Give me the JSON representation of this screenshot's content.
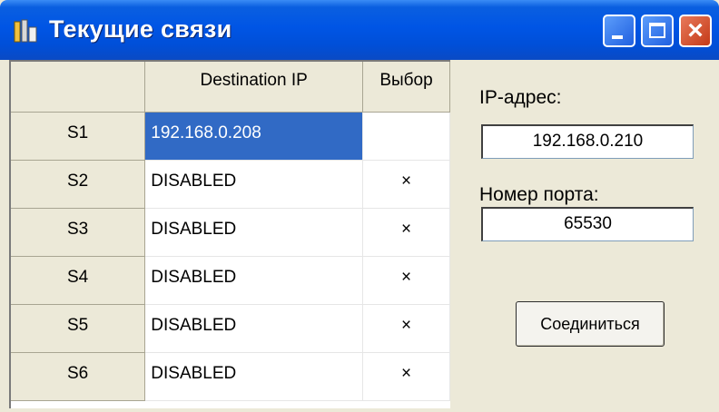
{
  "window": {
    "title": "Текущие связи",
    "controls": [
      "minimize",
      "maximize",
      "close"
    ]
  },
  "grid": {
    "columns": [
      "",
      "Destination IP",
      "Выбор"
    ],
    "rows": [
      {
        "id": "S1",
        "ip": "192.168.0.208",
        "selected_mark": "",
        "highlighted": true
      },
      {
        "id": "S2",
        "ip": "DISABLED",
        "selected_mark": "×"
      },
      {
        "id": "S3",
        "ip": "DISABLED",
        "selected_mark": "×"
      },
      {
        "id": "S4",
        "ip": "DISABLED",
        "selected_mark": "×"
      },
      {
        "id": "S5",
        "ip": "DISABLED",
        "selected_mark": "×"
      },
      {
        "id": "S6",
        "ip": "DISABLED",
        "selected_mark": "×"
      }
    ]
  },
  "panel": {
    "ip_label": "IP-адрес:",
    "ip_value": "192.168.0.210",
    "port_label": "Номер порта:",
    "port_value": "65530",
    "connect_label": "Соединиться"
  },
  "colors": {
    "titlebar": "#0055e5",
    "selection": "#316ac5",
    "close_button": "#c43a18",
    "face": "#ece9d8"
  }
}
